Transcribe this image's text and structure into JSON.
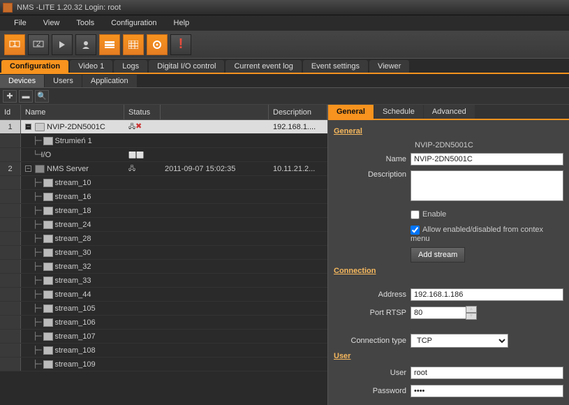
{
  "titlebar": {
    "text": "NMS -LITE  1.20.32 Login: root"
  },
  "menu": {
    "file": "File",
    "view": "View",
    "tools": "Tools",
    "configuration": "Configuration",
    "help": "Help"
  },
  "primaryTabs": {
    "configuration": "Configuration",
    "video1": "Video 1",
    "logs": "Logs",
    "digitalIO": "Digital I/O control",
    "currentEvent": "Current event log",
    "eventSettings": "Event settings",
    "viewer": "Viewer"
  },
  "secondaryTabs": {
    "devices": "Devices",
    "users": "Users",
    "application": "Application"
  },
  "gridHeaders": {
    "id": "Id",
    "name": "Name",
    "status": "Status",
    "description": "Description"
  },
  "tree": {
    "row1": {
      "id": "1",
      "name": "NVIP-2DN5001C",
      "desc": "192.168.1...."
    },
    "row1a": {
      "name": "Strumień 1"
    },
    "row1b": {
      "name": "I/O"
    },
    "row2": {
      "id": "2",
      "name": "NMS Server",
      "time": "2011-09-07 15:02:35",
      "desc": "10.11.21.2..."
    },
    "streams": [
      "stream_10",
      "stream_16",
      "stream_18",
      "stream_24",
      "stream_28",
      "stream_30",
      "stream_32",
      "stream_33",
      "stream_44",
      "stream_105",
      "stream_106",
      "stream_107",
      "stream_108",
      "stream_109"
    ]
  },
  "propTabs": {
    "general": "General",
    "schedule": "Schedule",
    "advanced": "Advanced"
  },
  "panel": {
    "section_general": "General",
    "device_name": "NVIP-2DN5001C",
    "name_label": "Name",
    "name_value": "NVIP-2DN5001C",
    "desc_label": "Description",
    "desc_value": "",
    "enable_label": "Enable",
    "allow_label": "Allow enabled/disabled from contex menu",
    "add_stream": "Add stream",
    "section_connection": "Connection",
    "address_label": "Address",
    "address_value": "192.168.1.186",
    "port_label": "Port RTSP",
    "port_value": "80",
    "conn_type_label": "Connection type",
    "conn_type_value": "TCP",
    "section_user": "User",
    "user_label": "User",
    "user_value": "root",
    "password_label": "Password",
    "password_value": "••••"
  }
}
